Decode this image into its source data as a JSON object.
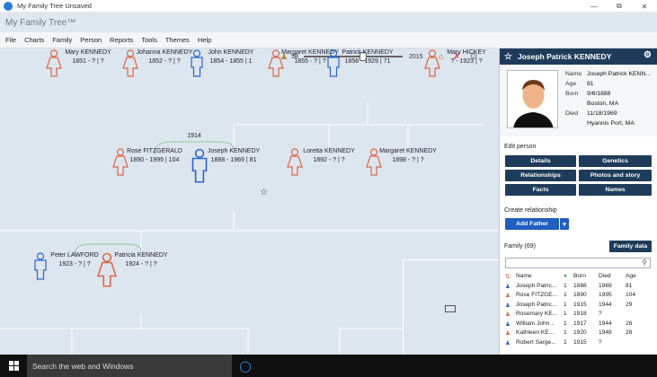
{
  "window": {
    "title": "My Family Tree Unsaved",
    "min": "—",
    "max": "⧉",
    "close": "✕"
  },
  "header": {
    "app_title": "My Family Tree™"
  },
  "menu": [
    "File",
    "Charts",
    "Family",
    "Person",
    "Reports",
    "Tools",
    "Themes",
    "Help"
  ],
  "toolbar": {
    "count": "58",
    "year": "2015"
  },
  "tree": {
    "people": [
      {
        "name": "Mary KENNEDY",
        "dates": "1851 - ? | ?",
        "sex": "f"
      },
      {
        "name": "Johanna KENNEDY",
        "dates": "1852 - ? | ?",
        "sex": "f"
      },
      {
        "name": "John KENNEDY",
        "dates": "1854 - 1855 | 1",
        "sex": "m"
      },
      {
        "name": "Margaret KENNEDY",
        "dates": "1855 - ? | ?",
        "sex": "f"
      },
      {
        "name": "Patrick KENNEDY",
        "dates": "1858 - 1929 | 71",
        "sex": "m"
      },
      {
        "name": "Mary HICKEY",
        "dates": "? - 1923 | ?",
        "sex": "f"
      },
      {
        "name": "Rose FITZGERALD",
        "dates": "1890 - 1995 | 104",
        "sex": "f"
      },
      {
        "name": "Joseph KENNEDY",
        "dates": "1888 - 1969 | 81",
        "sex": "m"
      },
      {
        "name": "Loretta KENNEDY",
        "dates": "1892 - ? | ?",
        "sex": "f"
      },
      {
        "name": "Margaret KENNEDY",
        "dates": "1898 - ? | ?",
        "sex": "f"
      },
      {
        "name": "Peter LAWFORD",
        "dates": "1923 - ? | ?",
        "sex": "m"
      },
      {
        "name": "Patricia KENNEDY",
        "dates": "1924 - ? | ?",
        "sex": "f"
      }
    ],
    "marriage_year": "1914"
  },
  "panel": {
    "person_name": "Joseph Patrick KENNEDY",
    "info": [
      {
        "k": "Name",
        "v": "Joseph Patrick KENN..."
      },
      {
        "k": "Age",
        "v": "81"
      },
      {
        "k": "Born",
        "v": "9/6/1888"
      },
      {
        "k": "",
        "v": "Boston, MA"
      },
      {
        "k": "Died",
        "v": "11/18/1969"
      },
      {
        "k": "",
        "v": "Hyannis Port, MA"
      }
    ],
    "edit_title": "Edit person",
    "edit_buttons": [
      "Details",
      "Genetics",
      "Relationships",
      "Photos and story",
      "Facts",
      "Names"
    ],
    "create_title": "Create relationship",
    "add_father": "Add Father",
    "family_title": "Family (69)",
    "family_data": "Family data",
    "columns": [
      "Name",
      "Born",
      "Died",
      "Age"
    ],
    "rows": [
      {
        "name": "Joseph Patric...",
        "n": "1",
        "born": "1888",
        "died": "1969",
        "age": "81",
        "sex": "m"
      },
      {
        "name": "Rose FITZGE...",
        "n": "1",
        "born": "1890",
        "died": "1995",
        "age": "104",
        "sex": "f"
      },
      {
        "name": "Joseph Patric...",
        "n": "1",
        "born": "1915",
        "died": "1944",
        "age": "29",
        "sex": "m"
      },
      {
        "name": "Rosemary KE...",
        "n": "1",
        "born": "1918",
        "died": "?",
        "age": "",
        "sex": "f"
      },
      {
        "name": "William John...",
        "n": "1",
        "born": "1917",
        "died": "1944",
        "age": "26",
        "sex": "m"
      },
      {
        "name": "Kathleen KE...",
        "n": "1",
        "born": "1920",
        "died": "1948",
        "age": "28",
        "sex": "f"
      },
      {
        "name": "Robert Sarge...",
        "n": "1",
        "born": "1915",
        "died": "?",
        "age": "",
        "sex": "m"
      }
    ]
  },
  "taskbar": {
    "search_text": "Search the web and Windows"
  },
  "colors": {
    "male": "#2e67c8",
    "female": "#d9694a",
    "panel_header": "#1f3b5a"
  }
}
